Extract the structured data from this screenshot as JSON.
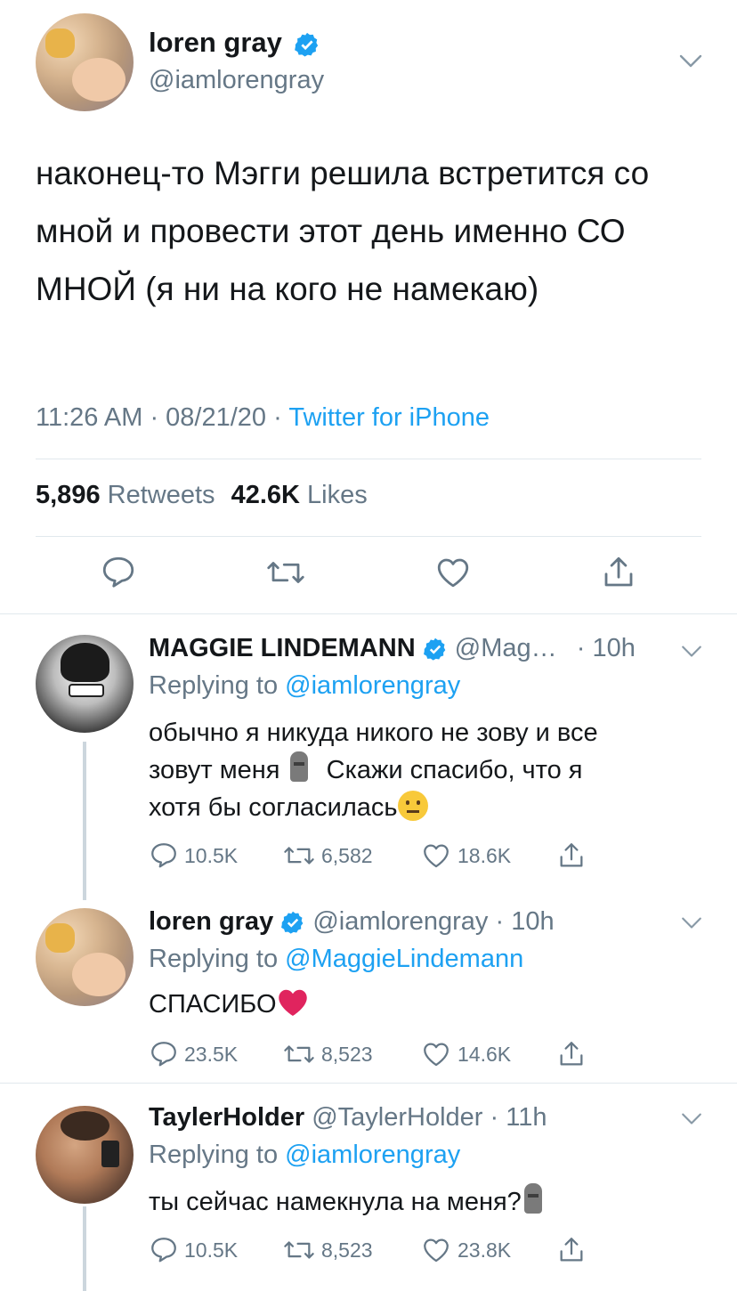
{
  "main_tweet": {
    "author_name": "loren gray",
    "author_handle": "@iamlorengray",
    "text": "наконец-то Мэгги решила встретится со мной и провести этот день именно СО МНОЙ (я ни на кого не намекаю)",
    "time": "11:26 AM",
    "date": "08/21/20",
    "source": "Twitter for iPhone",
    "retweets_count": "5,896",
    "retweets_label": "Retweets",
    "likes_count": "42.6K",
    "likes_label": "Likes"
  },
  "replies": [
    {
      "author_name": "MAGGIE LINDEMANN",
      "author_handle": "@Mag…",
      "age": "10h",
      "replying_prefix": "Replying to",
      "replying_to": "@iamlorengray",
      "text_line1": "обычно я никуда никого не зову и все",
      "text_line2a": "зовут меня",
      "text_line2b": "Скажи спасибо, что я",
      "text_line3": "хотя бы согласилась",
      "replies": "10.5K",
      "retweets": "6,582",
      "likes": "18.6K"
    },
    {
      "author_name": "loren gray",
      "author_handle": "@iamlorengray",
      "age": "10h",
      "replying_prefix": "Replying to",
      "replying_to": "@MaggieLindemann",
      "text": "СПАСИБО",
      "replies": "23.5K",
      "retweets": "8,523",
      "likes": "14.6K"
    },
    {
      "author_name": "TaylerHolder",
      "author_handle": "@TaylerHolder",
      "age": "11h",
      "replying_prefix": "Replying to",
      "replying_to": "@iamlorengray",
      "text": "ты сейчас намекнула на меня?",
      "replies": "10.5K",
      "retweets": "8,523",
      "likes": "23.8K"
    }
  ],
  "colors": {
    "accent": "#1da1f2",
    "text": "#14171a",
    "muted": "#657786",
    "divider": "#e1e8ed"
  },
  "icons": [
    "verified-badge-icon",
    "chevron-down-icon",
    "reply-icon",
    "retweet-icon",
    "like-icon",
    "share-icon",
    "moai-emoji",
    "neutral-face-emoji",
    "red-heart-emoji"
  ]
}
